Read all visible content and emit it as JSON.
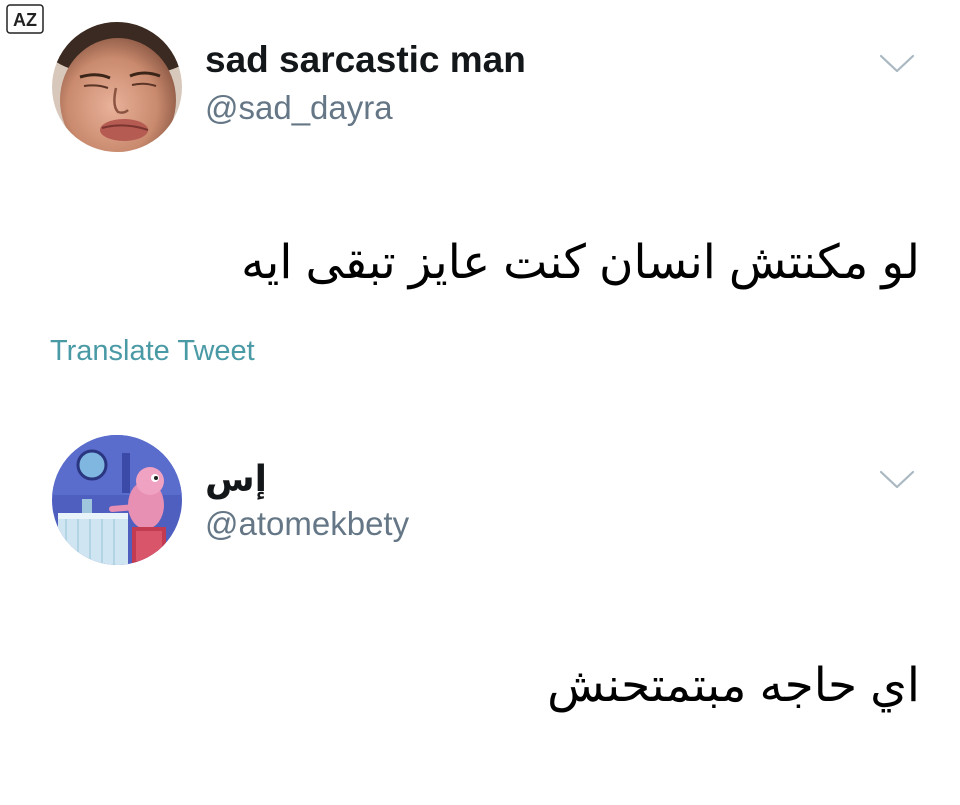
{
  "watermark": {
    "text": "AZ"
  },
  "tweets": [
    {
      "display_name": "sad sarcastic man",
      "handle": "@sad_dayra",
      "text": "لو مكنتش انسان كنت عايز تبقى ايه",
      "translate_label": "Translate Tweet",
      "menu_icon": "chevron-down-icon",
      "avatar_icon": "face-photo"
    },
    {
      "display_name": "إس",
      "handle": "@atomekbety",
      "text": "اي حاجه مبتمتحنش",
      "menu_icon": "chevron-down-icon",
      "avatar_icon": "cartoon-character"
    }
  ],
  "colors": {
    "handle": "#657786",
    "link": "#4a9aa6",
    "text": "#000000",
    "caret": "#aab8c2"
  }
}
